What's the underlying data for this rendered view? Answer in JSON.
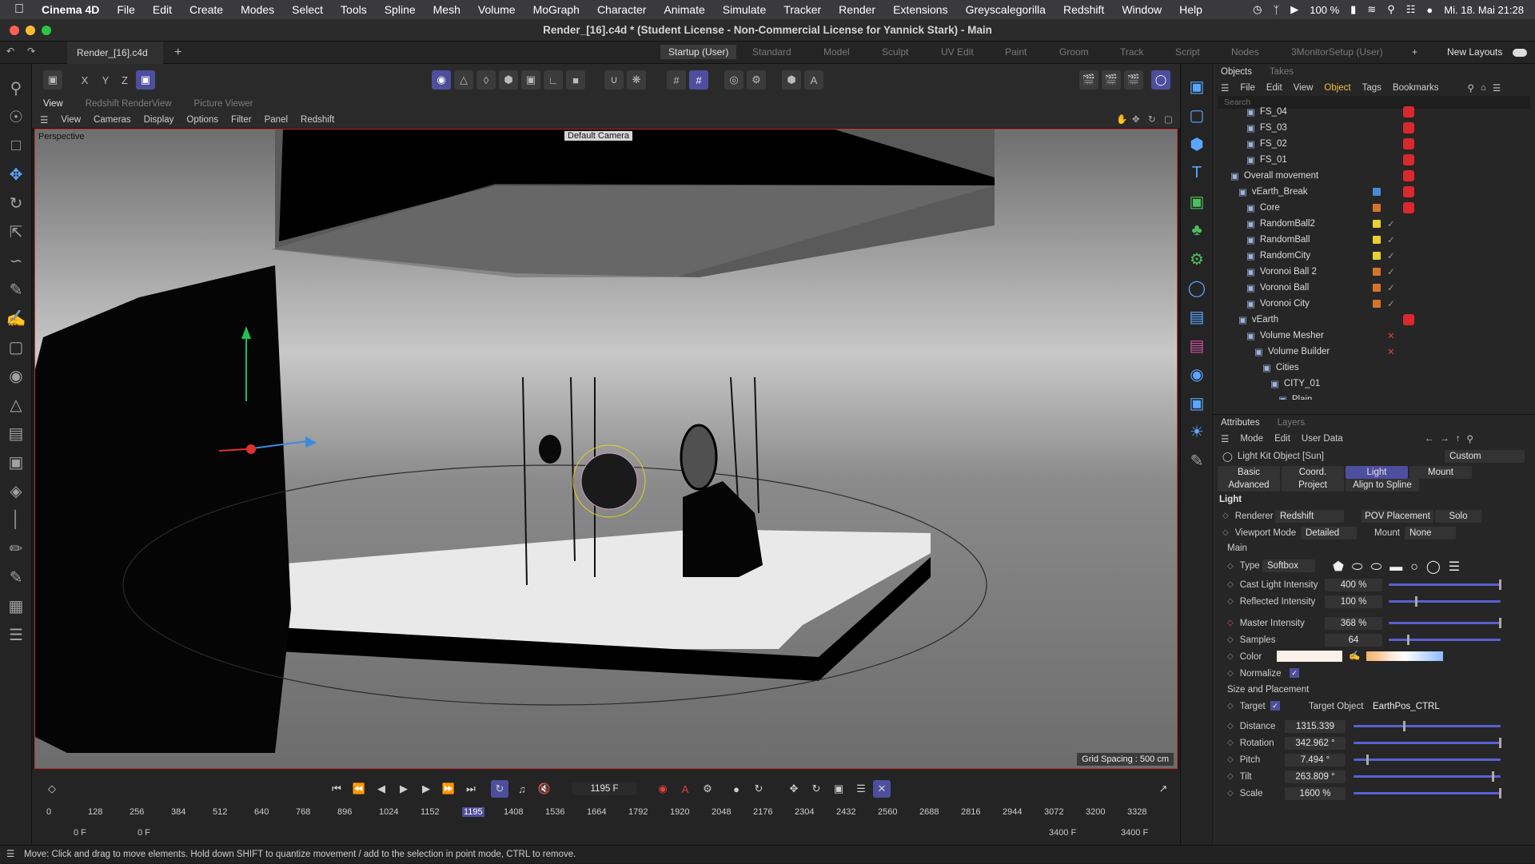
{
  "macbar": {
    "app_name": "Cinema 4D",
    "menus": [
      "File",
      "Edit",
      "Create",
      "Modes",
      "Select",
      "Tools",
      "Spline",
      "Mesh",
      "Volume",
      "MoGraph",
      "Character",
      "Animate",
      "Simulate",
      "Tracker",
      "Render",
      "Extensions",
      "Greyscalegorilla",
      "Redshift",
      "Window",
      "Help"
    ],
    "battery": "100 %",
    "datetime": "Mi. 18. Mai  21:28"
  },
  "window": {
    "title": "Render_[16].c4d * (Student License - Non-Commercial License for Yannick Stark) - Main",
    "doc_tab": "Render_[16].c4d *",
    "layouts": [
      "Startup (User)",
      "Standard",
      "Model",
      "Sculpt",
      "UV Edit",
      "Paint",
      "Groom",
      "Track",
      "Script",
      "Nodes",
      "3MonitorSetup (User)"
    ],
    "new_layouts": "New Layouts"
  },
  "viewtabs": [
    "View",
    "Redshift RenderView",
    "Picture Viewer"
  ],
  "viewport_menu": [
    "View",
    "Cameras",
    "Display",
    "Options",
    "Filter",
    "Panel",
    "Redshift"
  ],
  "viewport": {
    "projection": "Perspective",
    "camera": "Default Camera",
    "grid_spacing": "Grid Spacing : 500 cm"
  },
  "axis_toolbar": {
    "x": "X",
    "y": "Y",
    "z": "Z"
  },
  "objects_panel": {
    "tabs": [
      "Objects",
      "Takes"
    ],
    "menu": [
      "File",
      "Edit",
      "View",
      "Object",
      "Tags",
      "Bookmarks"
    ],
    "search_placeholder": "Search",
    "rows": [
      {
        "name": "FS_04",
        "color": "",
        "tags": "red"
      },
      {
        "name": "FS_03",
        "color": "",
        "tags": "red"
      },
      {
        "name": "FS_02",
        "color": "",
        "tags": "red"
      },
      {
        "name": "FS_01",
        "color": "",
        "tags": "red"
      },
      {
        "name": "Overall movement",
        "color": "",
        "tags": "red"
      },
      {
        "name": "vEarth_Break",
        "color": "#4a8ad4",
        "tags": "red"
      },
      {
        "name": "Core",
        "color": "#d7742b",
        "tags": "red"
      },
      {
        "name": "RandomBall2",
        "color": "#e3d32f",
        "tags": "check"
      },
      {
        "name": "RandomBall",
        "color": "#e3d32f",
        "tags": "check"
      },
      {
        "name": "RandomCity",
        "color": "#e3d32f",
        "tags": "check"
      },
      {
        "name": "Voronoi Ball 2",
        "color": "#d7742b",
        "tags": "check"
      },
      {
        "name": "Voronoi Ball",
        "color": "#d7742b",
        "tags": "check"
      },
      {
        "name": "Voronoi City",
        "color": "#d7742b",
        "tags": "check"
      },
      {
        "name": "vEarth",
        "color": "",
        "tags": "red"
      },
      {
        "name": "Volume Mesher",
        "color": "",
        "tags": "x"
      },
      {
        "name": "Volume Builder",
        "color": "",
        "tags": "x"
      },
      {
        "name": "Cities",
        "color": "",
        "tags": ""
      },
      {
        "name": "CITY_01",
        "color": "",
        "tags": ""
      },
      {
        "name": "Plain",
        "color": "",
        "tags": ""
      }
    ]
  },
  "attributes": {
    "tabs": [
      "Attributes",
      "Layers"
    ],
    "menu": [
      "Mode",
      "Edit",
      "User Data"
    ],
    "object_title": "Light Kit Object [Sun]",
    "preset": "Custom",
    "subtabs": [
      "Basic",
      "Coord.",
      "Light",
      "Mount",
      "Advanced",
      "Project",
      "Align to Spline"
    ],
    "active_subtab": "Light",
    "section": "Light",
    "renderer_label": "Renderer",
    "renderer": "Redshift",
    "pov": "POV Placement",
    "solo": "Solo",
    "viewport_mode_label": "Viewport Mode",
    "viewport_mode": "Detailed",
    "mount_label": "Mount",
    "mount": "None",
    "main_group": "Main",
    "type_label": "Type",
    "type": "Softbox",
    "cast_label": "Cast Light Intensity",
    "cast": "400 %",
    "cast_level": 1.0,
    "reflected_label": "Reflected Intensity",
    "reflected": "100 %",
    "reflected_level": 0.25,
    "master_label": "Master Intensity",
    "master": "368 %",
    "master_level": 1.0,
    "samples_label": "Samples",
    "samples": "64",
    "samples_level": 0.18,
    "color_label": "Color",
    "normalize_label": "Normalize",
    "size_group": "Size and Placement",
    "target_label": "Target",
    "target_object_label": "Target Object",
    "target_object": "EarthPos_CTRL",
    "distance_label": "Distance",
    "distance": "1315.339",
    "distance_level": 0.35,
    "rotation_label": "Rotation",
    "rotation": "342.962 °",
    "rotation_level": 1.0,
    "pitch_label": "Pitch",
    "pitch": "7.494 °",
    "pitch_level": 0.1,
    "tilt_label": "Tilt",
    "tilt": "263.809 °",
    "tilt_level": 0.95,
    "scale_label": "Scale",
    "scale": "1600 %",
    "scale_level": 1.0
  },
  "timeline": {
    "current_frame": "1195 F",
    "start": "0 F",
    "start2": "0 F",
    "end": "3400 F",
    "end2": "3400 F",
    "ticks": [
      "0",
      "128",
      "256",
      "384",
      "512",
      "640",
      "768",
      "896",
      "1024",
      "1152",
      "1195",
      "1408",
      "1536",
      "1664",
      "1792",
      "1920",
      "2048",
      "2176",
      "2304",
      "2432",
      "2560",
      "2688",
      "2816",
      "2944",
      "3072",
      "3200",
      "3328"
    ]
  },
  "status": "Move: Click and drag to move elements. Hold down SHIFT to quantize movement / add to the selection in point mode, CTRL to remove.",
  "colors": {
    "accent": "#4e4e9e",
    "viewport_border": "#c4302f",
    "highlight": "#f0c040"
  }
}
